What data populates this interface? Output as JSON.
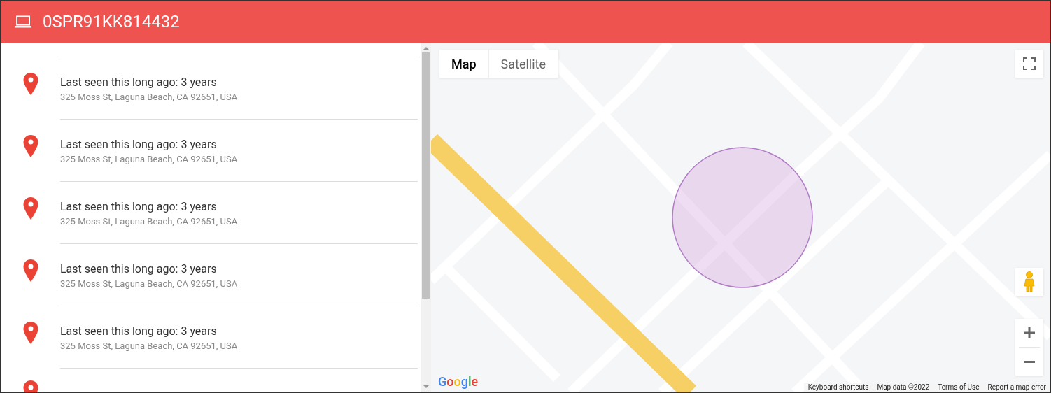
{
  "header": {
    "title": "0SPR91KK814432"
  },
  "locations": [
    {
      "title": "Last seen this long ago: 3 years",
      "address": "325 Moss St, Laguna Beach, CA 92651, USA"
    },
    {
      "title": "Last seen this long ago: 3 years",
      "address": "325 Moss St, Laguna Beach, CA 92651, USA"
    },
    {
      "title": "Last seen this long ago: 3 years",
      "address": "325 Moss St, Laguna Beach, CA 92651, USA"
    },
    {
      "title": "Last seen this long ago: 3 years",
      "address": "325 Moss St, Laguna Beach, CA 92651, USA"
    },
    {
      "title": "Last seen this long ago: 3 years",
      "address": "325 Moss St, Laguna Beach, CA 92651, USA"
    }
  ],
  "map": {
    "map_types": [
      {
        "label": "Map",
        "selected": true
      },
      {
        "label": "Satellite",
        "selected": false
      }
    ],
    "logo": "Google",
    "footer": [
      "Keyboard shortcuts",
      "Map data ©2022",
      "Terms of Use",
      "Report a map error"
    ]
  }
}
